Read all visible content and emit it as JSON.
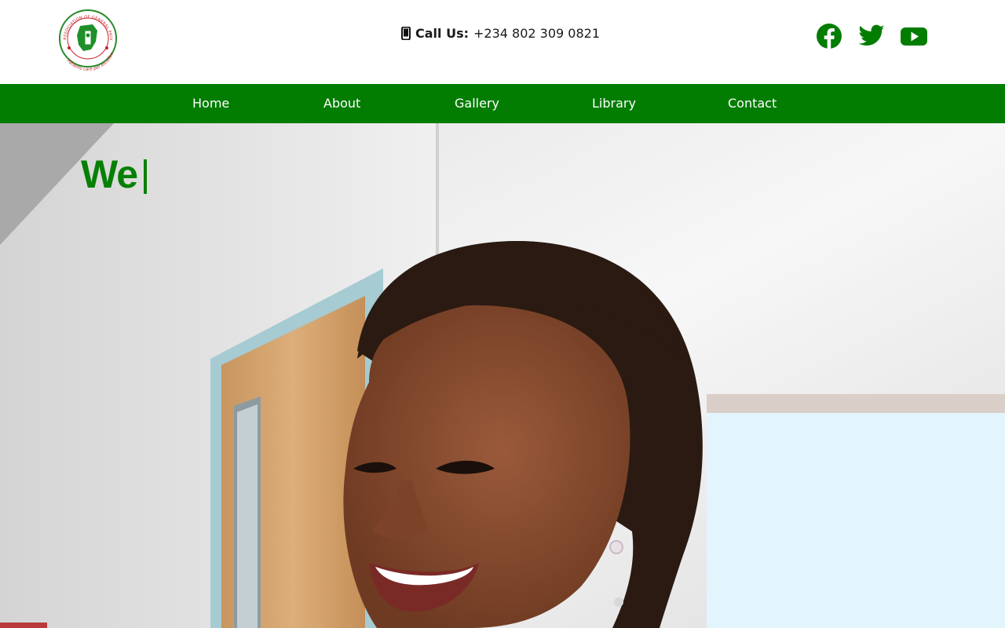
{
  "header": {
    "logo": {
      "ring_text": "ASSOCIATION OF GENERAL PRIVATE NURSING PRACTITIONERS",
      "motto": "Patients care per excellence"
    },
    "call": {
      "label": "Call Us:",
      "number": "+234 802 309 0821",
      "icon": "mobile-phone-icon"
    },
    "socials": [
      {
        "name": "facebook",
        "icon": "facebook-icon"
      },
      {
        "name": "twitter",
        "icon": "twitter-icon"
      },
      {
        "name": "youtube",
        "icon": "youtube-icon"
      }
    ]
  },
  "nav": {
    "items": [
      {
        "label": "Home"
      },
      {
        "label": "About"
      },
      {
        "label": "Gallery"
      },
      {
        "label": "Library"
      },
      {
        "label": "Contact"
      }
    ]
  },
  "hero": {
    "title": "We"
  },
  "colors": {
    "brand_green": "#027d02",
    "title_green": "#058005",
    "logo_red": "#c8202a"
  }
}
